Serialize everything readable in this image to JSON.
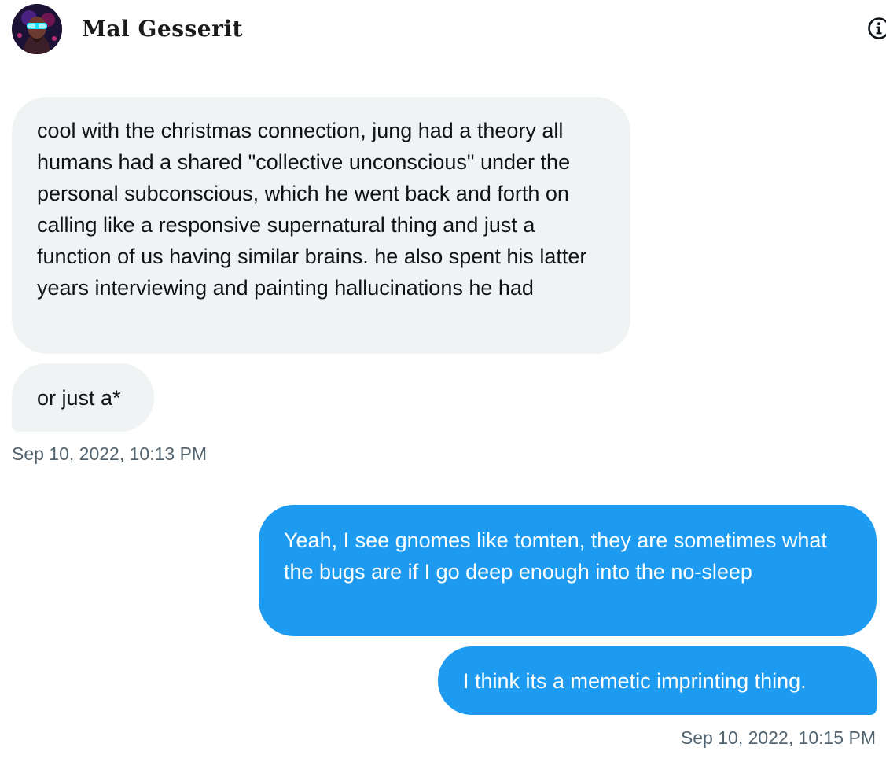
{
  "header": {
    "contact_name": "Mal Gesserit",
    "avatar_icon": "avatar-image",
    "info_icon": "info-icon"
  },
  "conversation": {
    "messages": [
      {
        "direction": "incoming",
        "text": "cool with the christmas connection, jung had a theory all humans had a shared \"collective unconscious\" under the personal subconscious, which he went back and forth on calling like a responsive supernatural thing and just a function of us having similar brains. he also spent his latter years interviewing and painting hallucinations he had"
      },
      {
        "direction": "incoming",
        "text": "or just a*"
      },
      {
        "direction": "outgoing",
        "text": "Yeah, I see gnomes like tomten, they are sometimes what the bugs are if I go deep enough into the no-sleep"
      },
      {
        "direction": "outgoing",
        "text": "I think its a memetic imprinting thing."
      }
    ],
    "timestamps": [
      "Sep 10, 2022, 10:13 PM",
      "Sep 10, 2022, 10:15 PM"
    ]
  },
  "colors": {
    "incoming_bubble": "#eff3f4",
    "outgoing_bubble": "#1d9bf0",
    "timestamp_text": "#536471",
    "body_text": "#0f1419"
  }
}
